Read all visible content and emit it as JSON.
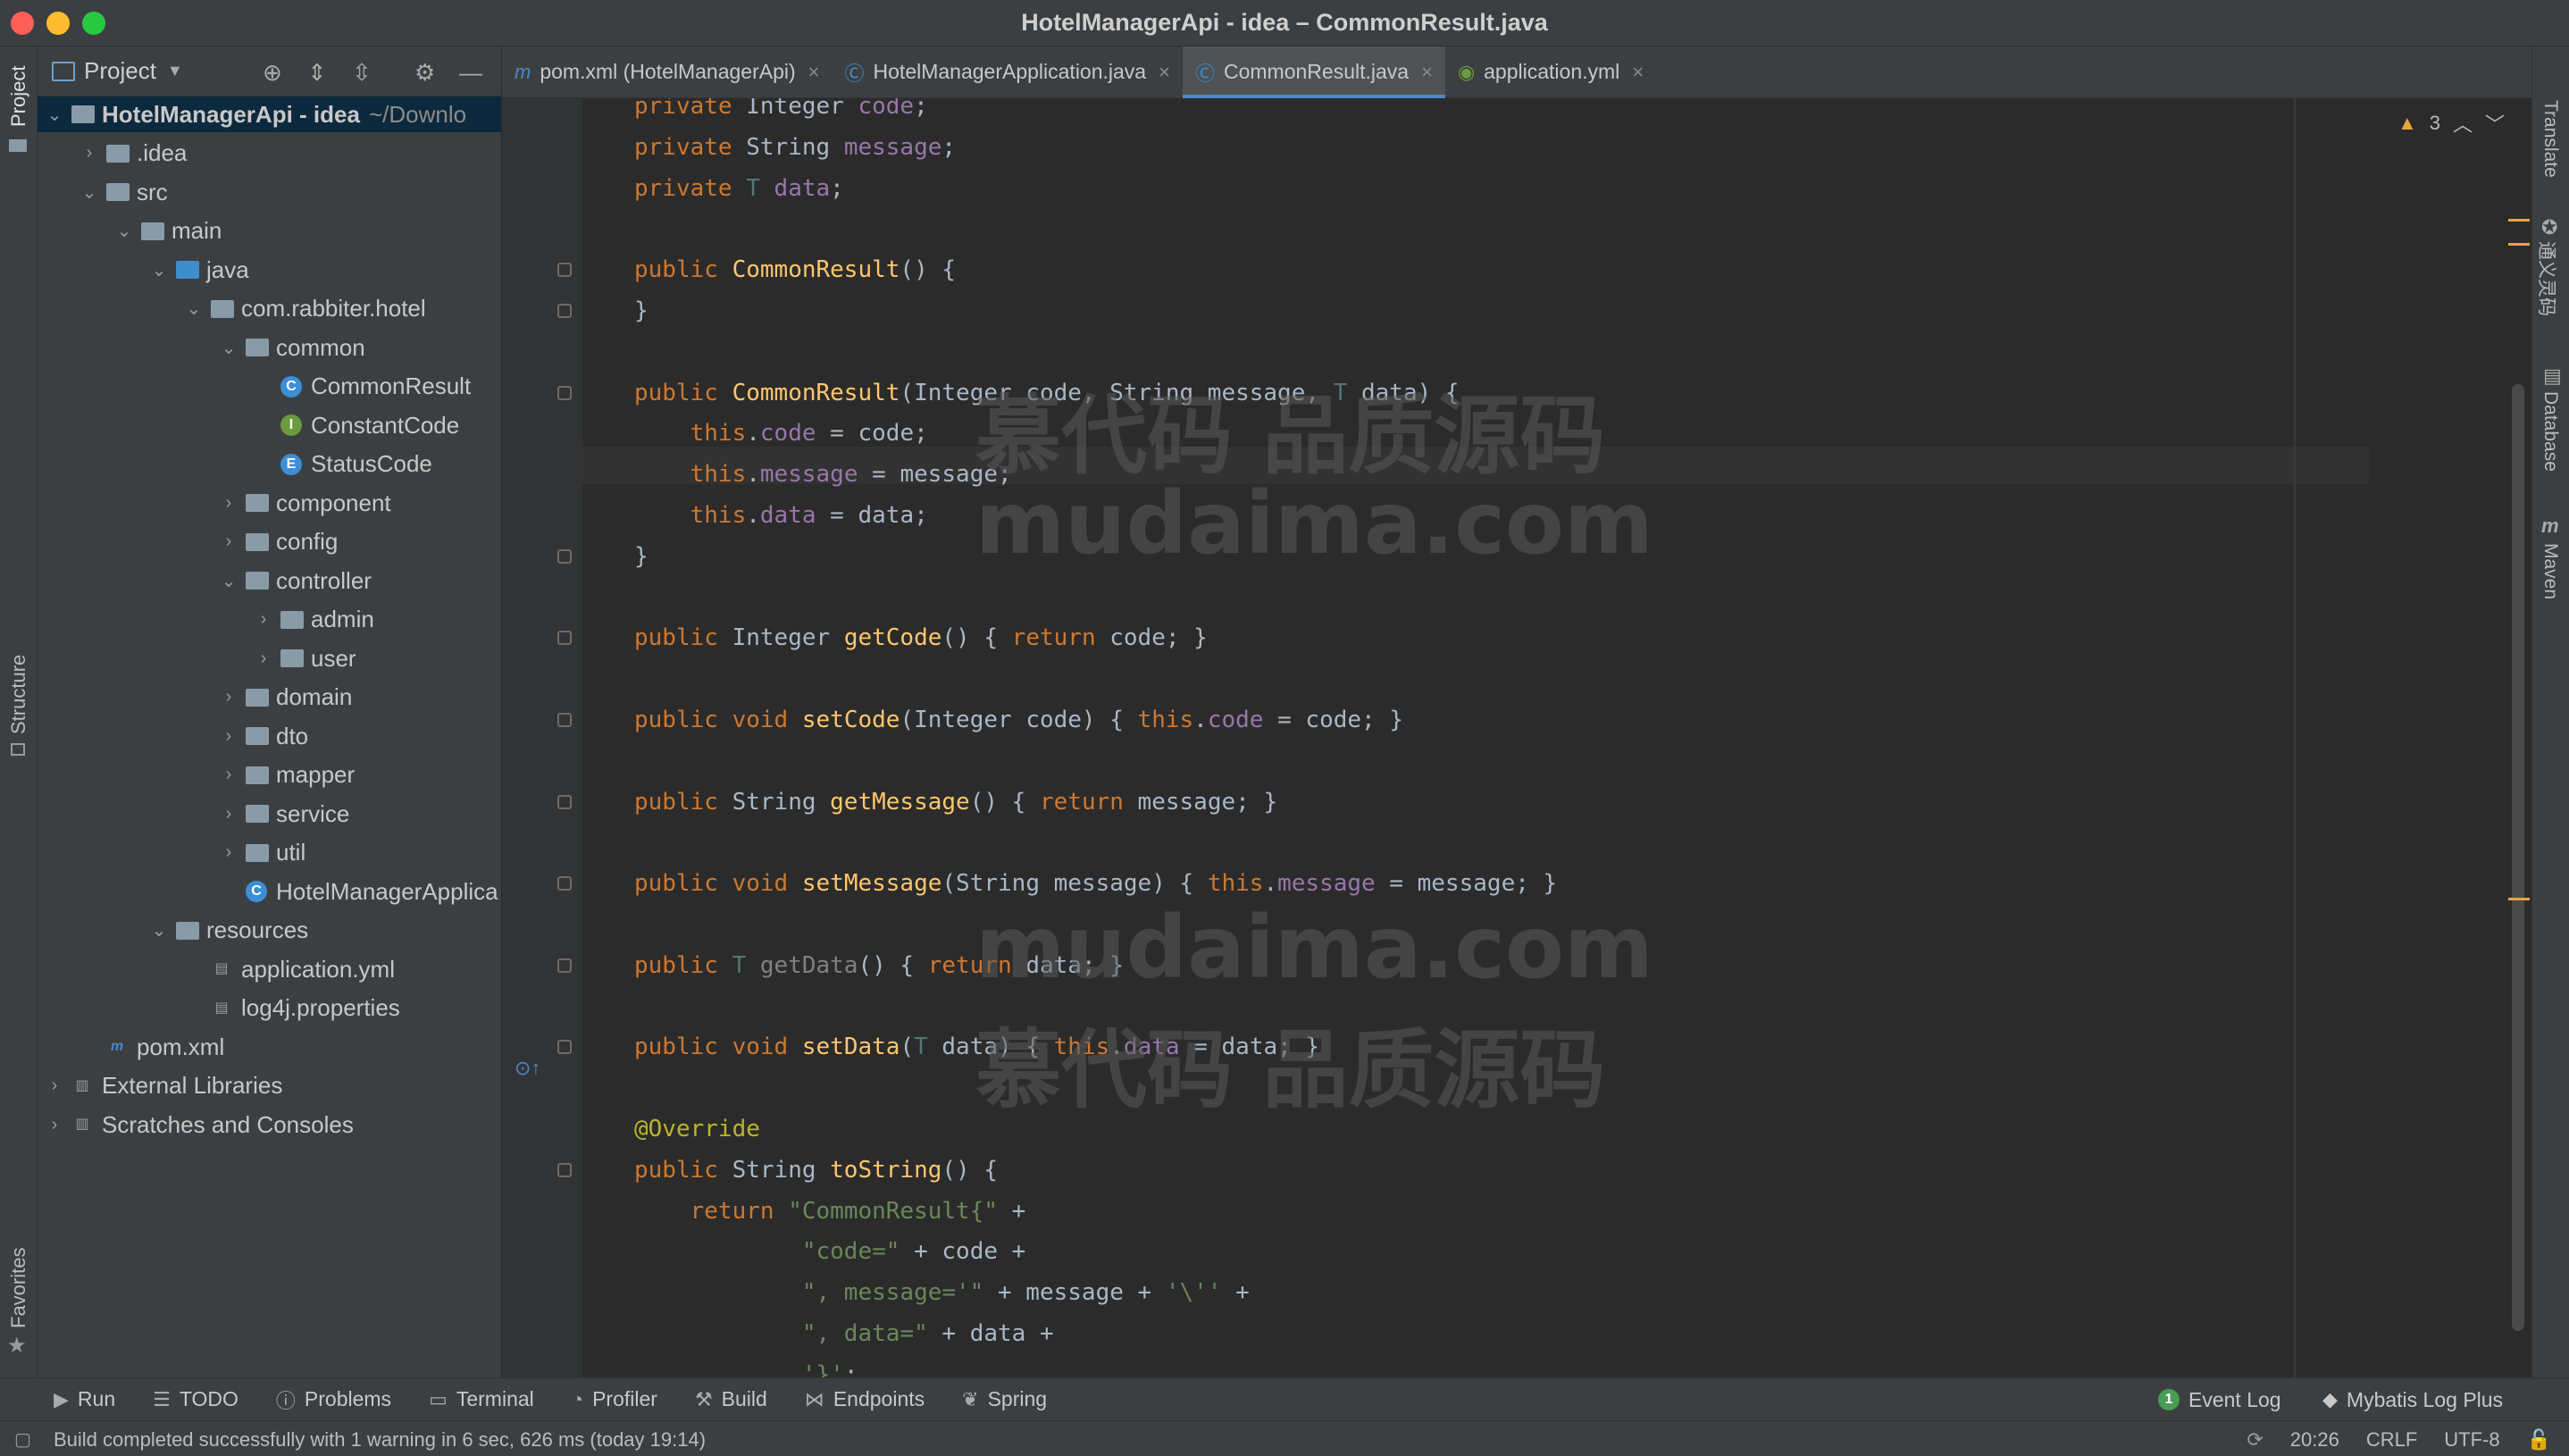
{
  "window": {
    "title": "HotelManagerApi - idea – CommonResult.java"
  },
  "left_stripe": {
    "project": "Project",
    "structure": "Structure",
    "favorites": "Favorites"
  },
  "right_stripe": {
    "translate": "Translate",
    "tongyi": "通义灵码",
    "database": "Database",
    "maven": "Maven"
  },
  "project_panel": {
    "title": "Project",
    "tree": [
      {
        "label": "HotelManagerApi - idea",
        "hint": "~/Downlo",
        "kind": "module",
        "arrow": "v"
      },
      {
        "label": ".idea",
        "kind": "folder",
        "arrow": ">"
      },
      {
        "label": "src",
        "kind": "folder",
        "arrow": "v"
      },
      {
        "label": "main",
        "kind": "folder",
        "arrow": "v"
      },
      {
        "label": "java",
        "kind": "folder-blue",
        "arrow": "v"
      },
      {
        "label": "com.rabbiter.hotel",
        "kind": "folder",
        "arrow": "v"
      },
      {
        "label": "common",
        "kind": "folder",
        "arrow": "v"
      },
      {
        "label": "CommonResult",
        "kind": "class-c",
        "arrow": ""
      },
      {
        "label": "ConstantCode",
        "kind": "class-i",
        "arrow": ""
      },
      {
        "label": "StatusCode",
        "kind": "class-e",
        "arrow": ""
      },
      {
        "label": "component",
        "kind": "folder",
        "arrow": ">"
      },
      {
        "label": "config",
        "kind": "folder",
        "arrow": ">"
      },
      {
        "label": "controller",
        "kind": "folder",
        "arrow": "v"
      },
      {
        "label": "admin",
        "kind": "folder",
        "arrow": ">"
      },
      {
        "label": "user",
        "kind": "folder",
        "arrow": ">"
      },
      {
        "label": "domain",
        "kind": "folder",
        "arrow": ">"
      },
      {
        "label": "dto",
        "kind": "folder",
        "arrow": ">"
      },
      {
        "label": "mapper",
        "kind": "folder",
        "arrow": ">"
      },
      {
        "label": "service",
        "kind": "folder",
        "arrow": ">"
      },
      {
        "label": "util",
        "kind": "folder",
        "arrow": ">"
      },
      {
        "label": "HotelManagerApplica",
        "kind": "class-c",
        "arrow": ""
      },
      {
        "label": "resources",
        "kind": "folder",
        "arrow": "v"
      },
      {
        "label": "application.yml",
        "kind": "file",
        "arrow": ""
      },
      {
        "label": "log4j.properties",
        "kind": "file",
        "arrow": ""
      },
      {
        "label": "pom.xml",
        "kind": "file-m",
        "arrow": ""
      },
      {
        "label": "External Libraries",
        "kind": "lib",
        "arrow": ">"
      },
      {
        "label": "Scratches and Consoles",
        "kind": "lib",
        "arrow": ">"
      }
    ]
  },
  "tabs": [
    {
      "label": "pom.xml (HotelManagerApi)",
      "icon": "m",
      "active": false
    },
    {
      "label": "HotelManagerApplication.java",
      "icon": "C",
      "active": false
    },
    {
      "label": "CommonResult.java",
      "icon": "C",
      "active": true
    },
    {
      "label": "application.yml",
      "icon": "yml",
      "active": false
    }
  ],
  "editor": {
    "warnings_count": "3",
    "lines": [
      "private Integer code;",
      "private String message;",
      "private T data;",
      "",
      "public CommonResult() {",
      "}",
      "",
      "public CommonResult(Integer code, String message, T data) {",
      "    this.code = code;",
      "    this.message = message;",
      "    this.data = data;",
      "}",
      "",
      "public Integer getCode() { return code; }",
      "",
      "public void setCode(Integer code) { this.code = code; }",
      "",
      "public String getMessage() { return message; }",
      "",
      "public void setMessage(String message) { this.message = message; }",
      "",
      "public T getData() { return data; }",
      "",
      "public void setData(T data) { this.data = data; }",
      "",
      "@Override",
      "public String toString() {",
      "    return \"CommonResult{\" +",
      "            \"code=\" + code +",
      "            \", message='\" + message + '\\'' +",
      "            \", data=\" + data +",
      "            '}';",
      "}",
      "}"
    ]
  },
  "watermarks": [
    "慕代码 品质源码",
    "mudaima.com",
    "mudaima.com",
    "慕代码 品质源码"
  ],
  "bottom_tools": [
    "Run",
    "TODO",
    "Problems",
    "Terminal",
    "Profiler",
    "Build",
    "Endpoints",
    "Spring"
  ],
  "bottom_right": {
    "event_log": "Event Log",
    "event_count": "1",
    "mybatis": "Mybatis Log Plus"
  },
  "status": {
    "message": "Build completed successfully with 1 warning in 6 sec, 626 ms (today 19:14)",
    "time": "20:26",
    "line_sep": "CRLF",
    "encoding": "UTF-8"
  }
}
